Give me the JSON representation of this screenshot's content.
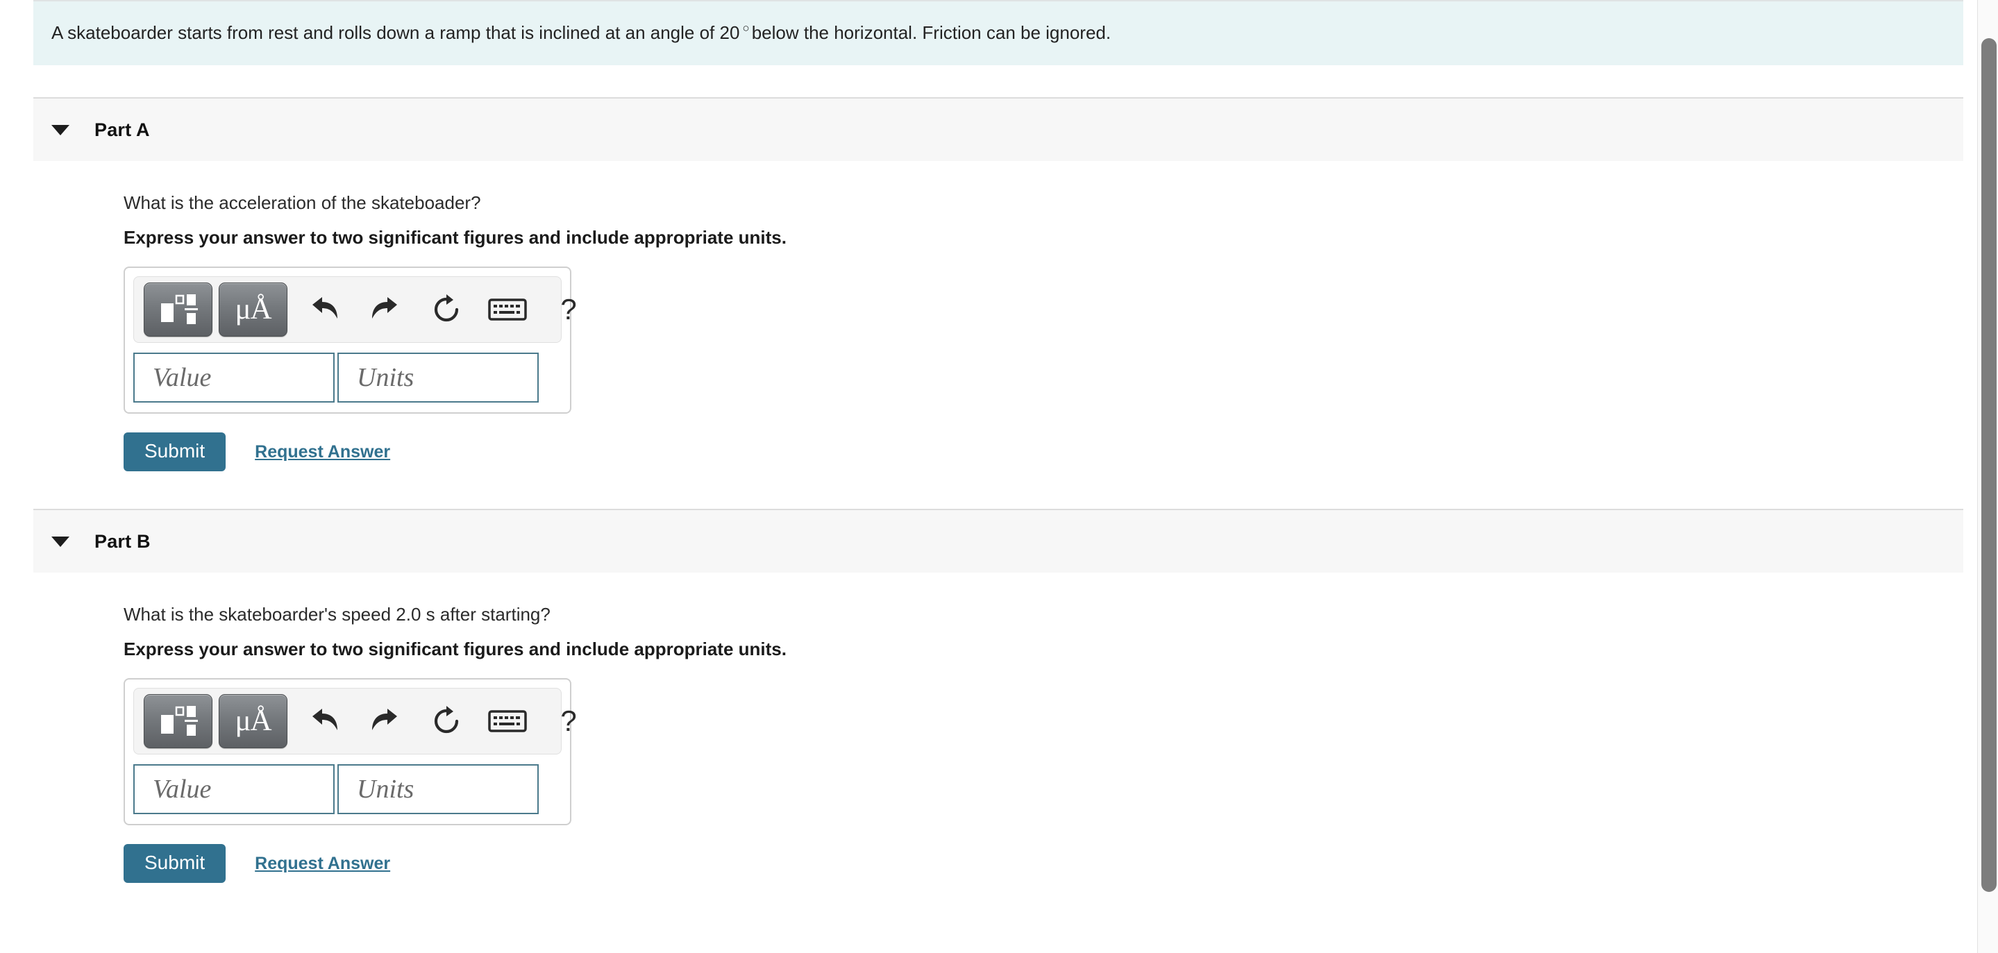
{
  "problem": {
    "text_before_degree": "A skateboarder starts from rest and rolls down a ramp that is inclined at an angle of 20",
    "degree_symbol": "○",
    "text_after_degree": "below the horizontal. Friction can be ignored."
  },
  "parts": [
    {
      "header_title": "Part A",
      "caret_icon": "caret-down-icon",
      "question": "What is the acceleration of the skateboader?",
      "instruction": "Express your answer to two significant figures and include appropriate units.",
      "toolbar": {
        "template_button_icon": "math-template-icon",
        "units_button_label": "μÅ",
        "units_button_icon": "units-mu-angstrom-icon",
        "undo_icon": "undo-arrow-icon",
        "redo_icon": "redo-arrow-icon",
        "reset_icon": "reset-circular-arrow-icon",
        "keyboard_icon": "keyboard-icon",
        "help_label": "?",
        "help_icon": "question-mark-help-icon"
      },
      "fields": {
        "value_placeholder": "Value",
        "units_placeholder": "Units",
        "value_text": "",
        "units_text": ""
      },
      "submit_label": "Submit",
      "request_answer_label": "Request Answer"
    },
    {
      "header_title": "Part B",
      "caret_icon": "caret-down-icon",
      "question": "What is the skateboarder's speed 2.0 s after starting?",
      "instruction": "Express your answer to two significant figures and include appropriate units.",
      "toolbar": {
        "template_button_icon": "math-template-icon",
        "units_button_label": "μÅ",
        "units_button_icon": "units-mu-angstrom-icon",
        "undo_icon": "undo-arrow-icon",
        "redo_icon": "redo-arrow-icon",
        "reset_icon": "reset-circular-arrow-icon",
        "keyboard_icon": "keyboard-icon",
        "help_label": "?",
        "help_icon": "question-mark-help-icon"
      },
      "fields": {
        "value_placeholder": "Value",
        "units_placeholder": "Units",
        "value_text": "",
        "units_text": ""
      },
      "submit_label": "Submit",
      "request_answer_label": "Request Answer"
    }
  ],
  "colors": {
    "banner_background": "#e8f4f5",
    "part_header_background": "#f7f7f7",
    "submit_button": "#31718f",
    "link": "#31718f",
    "field_border": "#4b7a8c",
    "scrollbar_thumb": "#7d7d7d"
  }
}
